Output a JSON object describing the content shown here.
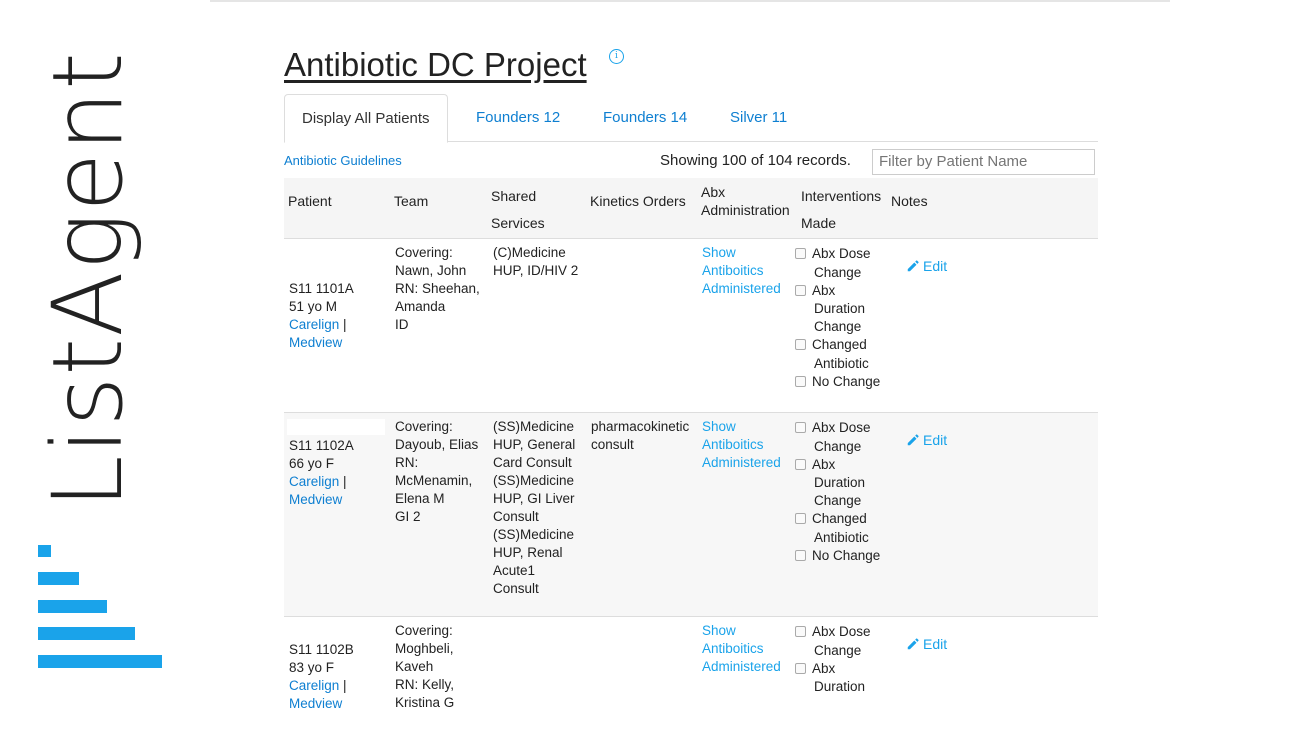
{
  "brand": {
    "name": "ListAgent"
  },
  "header": {
    "title": "Antibiotic DC Project",
    "info_icon": "i"
  },
  "tabs": [
    {
      "label": "Display All Patients"
    },
    {
      "label": "Founders 12"
    },
    {
      "label": "Founders 14"
    },
    {
      "label": "Silver 11"
    }
  ],
  "toolbar": {
    "guidelines_link": "Antibiotic Guidelines",
    "records_text": "Showing 100 of 104 records.",
    "filter_placeholder": "Filter by Patient Name"
  },
  "table": {
    "headers": {
      "patient": "Patient",
      "team": "Team",
      "shared_1": "Shared",
      "shared_2": "Services",
      "kinetics": "Kinetics Orders",
      "abx_1": "Abx",
      "abx_2": "Administration",
      "interventions_1": "Interventions",
      "interventions_2": "Made",
      "notes": "Notes"
    },
    "intervention_labels": {
      "dose_1": "Abx Dose",
      "dose_2": "Change",
      "duration_1": "Abx",
      "duration_2": "Duration",
      "duration_3": "Change",
      "changed_1": "Changed",
      "changed_2": "Antibiotic",
      "nochange": "No Change"
    },
    "abx_link": {
      "l1": "Show",
      "l2": "Antiboitics",
      "l3": "Administered"
    },
    "edit_label": "Edit",
    "carelign": "Carelign",
    "sep": " |",
    "medview": "Medview",
    "rows": [
      {
        "id": "S11 1101A",
        "age_sex": "51 yo M",
        "team": [
          "Covering:",
          "Nawn, John",
          "RN: Sheehan,",
          "Amanda",
          "ID"
        ],
        "shared": [
          "(C)Medicine",
          "HUP, ID/HIV 2"
        ],
        "kinetics": []
      },
      {
        "id": "S11 1102A",
        "age_sex": "66 yo F",
        "team": [
          "Covering:",
          "Dayoub, Elias",
          "RN:",
          "McMenamin,",
          "Elena M",
          "GI 2"
        ],
        "shared": [
          "(SS)Medicine",
          "HUP, General",
          "Card Consult",
          "(SS)Medicine",
          "HUP, GI Liver",
          "Consult",
          "(SS)Medicine",
          "HUP, Renal",
          "Acute1",
          "Consult"
        ],
        "kinetics": [
          "pharmacokinetic",
          "consult"
        ]
      },
      {
        "id": "S11 1102B",
        "age_sex": "83 yo F",
        "team": [
          "Covering:",
          "Moghbeli,",
          "Kaveh",
          "RN: Kelly,",
          "Kristina G"
        ],
        "shared": [],
        "kinetics": []
      }
    ]
  },
  "colors": {
    "accent": "#1aa3ea",
    "link": "#0e7fd1"
  }
}
